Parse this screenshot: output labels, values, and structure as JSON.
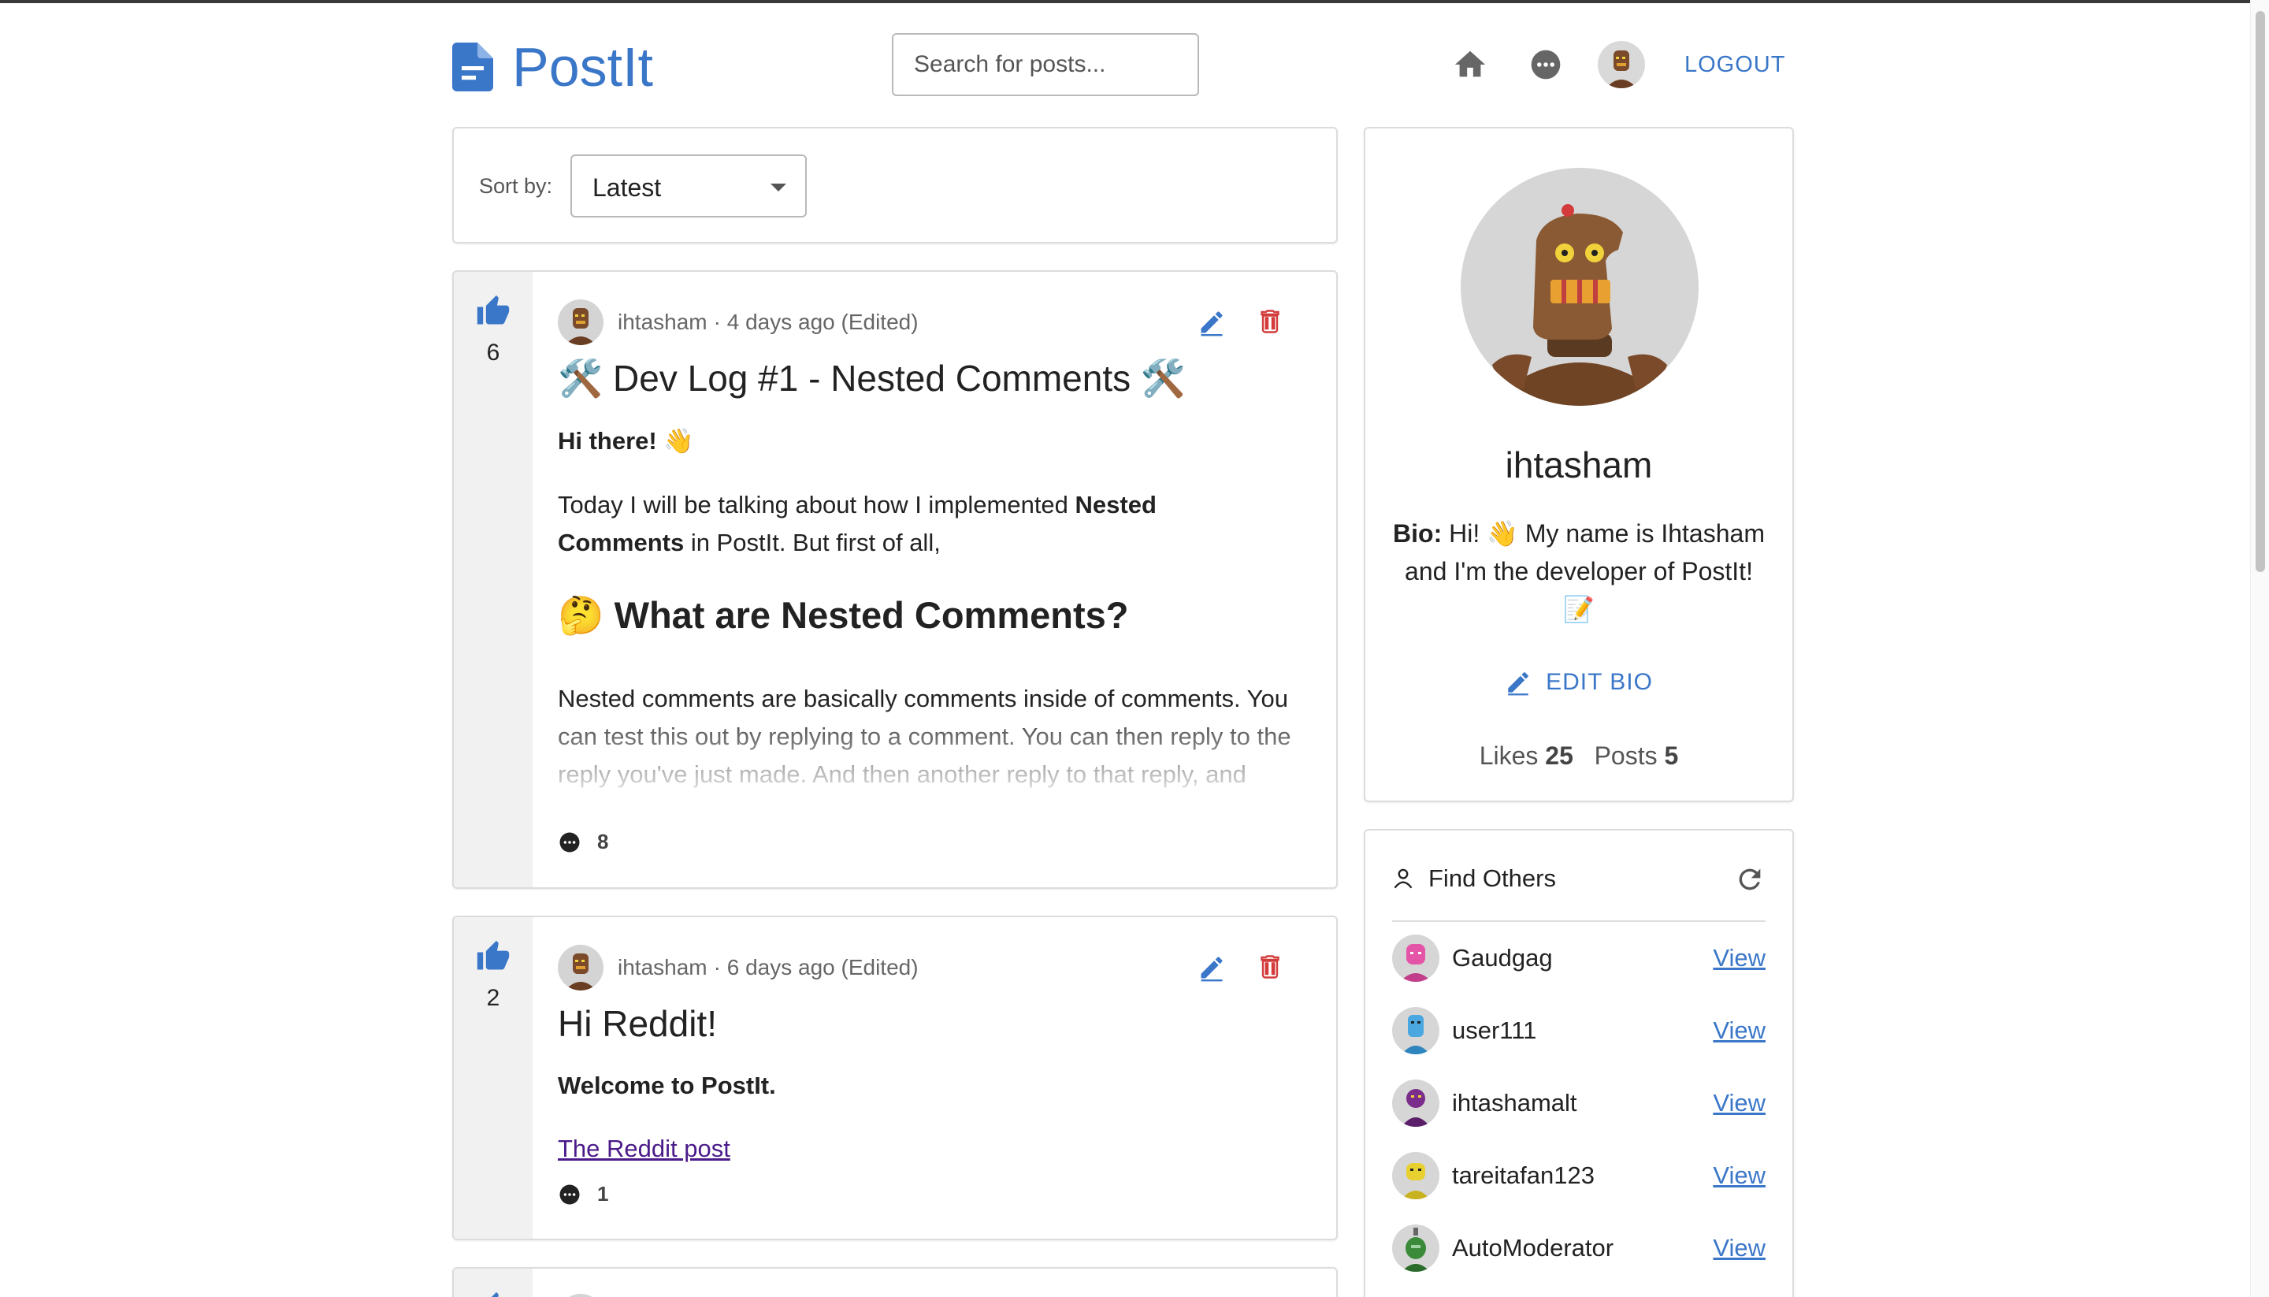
{
  "header": {
    "app_name": "PostIt",
    "search_placeholder": "Search for posts...",
    "logout_label": "LOGOUT"
  },
  "sort": {
    "label": "Sort by:",
    "selected": "Latest"
  },
  "posts": [
    {
      "likes": "6",
      "author": "ihtasham",
      "meta": "· 4 days ago (Edited)",
      "title": "🛠️ Dev Log #1 - Nested Comments 🛠️",
      "greeting": "Hi there! 👋",
      "intro_1": "Today I will be talking about how I implemented ",
      "intro_bold": "Nested Comments",
      "intro_2": " in PostIt. But first of all,",
      "heading": "🤔 What are Nested Comments?",
      "body": "Nested comments are basically comments inside of comments. You can test this out by replying to a comment. You can then reply to the reply you've just made. And then another reply to that reply, and another... infinitely.",
      "comments": "8"
    },
    {
      "likes": "2",
      "author": "ihtasham",
      "meta": "· 6 days ago (Edited)",
      "title": "Hi Reddit!",
      "greeting": "Welcome to PostIt.",
      "link": "The Reddit post",
      "comments": "1"
    }
  ],
  "profile": {
    "username": "ihtasham",
    "bio_label": "Bio:",
    "bio_text": " Hi! 👋 My name is Ihtasham and I'm the developer of PostIt! 📝",
    "edit_bio_label": "EDIT BIO",
    "likes_label": "Likes",
    "likes_value": "25",
    "posts_label": "Posts",
    "posts_value": "5"
  },
  "find_others": {
    "title": "Find Others",
    "view_label": "View",
    "users": [
      {
        "name": "Gaudgag",
        "color": "#e455a8"
      },
      {
        "name": "user111",
        "color": "#4aa7e0"
      },
      {
        "name": "ihtashamalt",
        "color": "#7a2d8a"
      },
      {
        "name": "tareitafan123",
        "color": "#e8d030"
      },
      {
        "name": "AutoModerator",
        "color": "#3a8a3a"
      }
    ]
  },
  "colors": {
    "accent": "#3b77c8",
    "delete": "#d43b3b",
    "link_visited": "#4b1b8a"
  }
}
